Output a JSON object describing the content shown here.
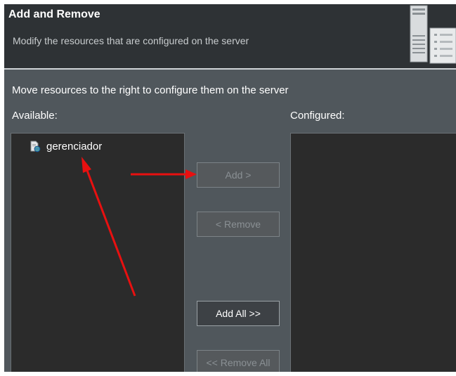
{
  "header": {
    "title": "Add and Remove",
    "description": "Modify the resources that are configured on the server",
    "icon": "server-icon"
  },
  "main": {
    "instruction": "Move resources to the right to configure them on the server",
    "available_label": "Available:",
    "configured_label": "Configured:",
    "available_items": [
      {
        "label": "gerenciador",
        "icon": "web-project-icon"
      }
    ],
    "configured_items": []
  },
  "buttons": {
    "add": "Add >",
    "remove": "< Remove",
    "add_all": "Add All >>",
    "remove_all": "<< Remove All"
  },
  "colors": {
    "background": "#50575c",
    "header_background": "#2e3235",
    "list_background": "#2b2b2b",
    "annotation_arrow": "#e81010"
  }
}
